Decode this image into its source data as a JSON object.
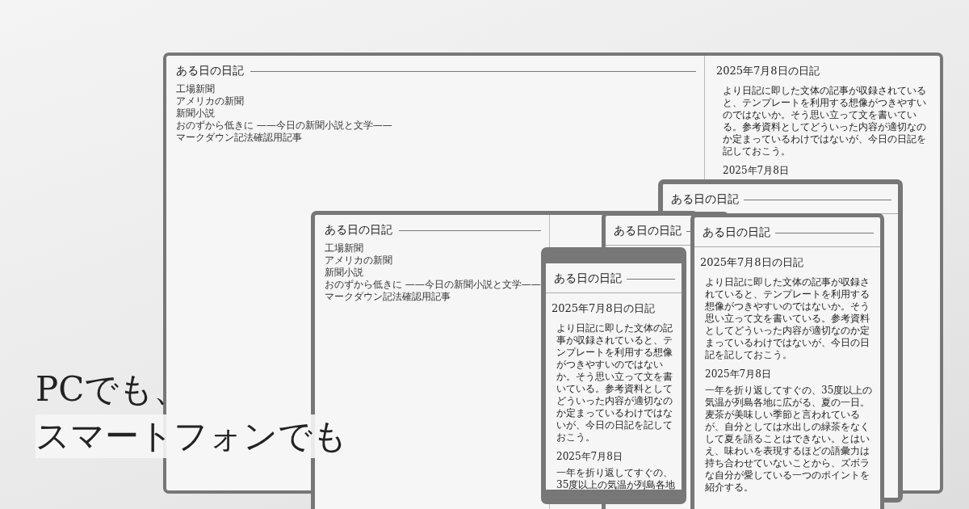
{
  "devices": [
    {
      "kind": "desktop",
      "title": "ある日の日記",
      "links": [
        "工場新聞",
        "アメリカの新聞",
        "新聞小説",
        "おのずから低きに ——今日の新聞小説と文学——",
        "マークダウン記法確認用記事"
      ],
      "heading": "2025年7月8日の日記",
      "blocks": [
        {
          "kind": "paragraph",
          "text": "より日記に即した文体の記事が収録されていると、テンプレートを利用する想像がつきやすいのではないか。そう思い立って文を書いている。参考資料としてどういった内容が適切なのか定まっているわけではないが、今日の日記を記しておこう。"
        },
        {
          "kind": "subheading",
          "text": "2025年7月8日"
        }
      ]
    },
    {
      "kind": "phone",
      "title": "ある日の日記"
    },
    {
      "kind": "desktop",
      "title": "ある日の日記",
      "links": [
        "工場新聞",
        "アメリカの新聞",
        "新聞小説",
        "おのずから低きに ——今日の新聞小説と文学——",
        "マークダウン記法確認用記事"
      ]
    },
    {
      "kind": "phone",
      "title": "ある日の日記"
    },
    {
      "kind": "phone",
      "title": "ある日の日記",
      "heading": "2025年7月8日の日記",
      "blocks": [
        {
          "kind": "paragraph",
          "text": "より日記に即した文体の記事が収録されていると、テンプレートを利用する想像がつきやすいのではないか。そう思い立って文を書いている。参考資料としてどういった内容が適切なのか定まっているわけではないが、今日の日記を記しておこう。"
        },
        {
          "kind": "subheading",
          "text": "2025年7月8日"
        },
        {
          "kind": "paragraph",
          "text": "一年を折り返してすぐの、35度以上の気温が列島各地"
        }
      ]
    },
    {
      "kind": "phone",
      "title": "ある日の日記",
      "heading": "2025年7月8日の日記",
      "blocks": [
        {
          "kind": "paragraph",
          "text": "より日記に即した文体の記事が収録されていると、テンプレートを利用する想像がつきやすいのではないか。そう思い立って文を書いている。参考資料としてどういった内容が適切なのか定まっているわけではないが、今日の日記を記しておこう。"
        },
        {
          "kind": "subheading",
          "text": "2025年7月8日"
        },
        {
          "kind": "paragraph",
          "text": "一年を折り返してすぐの、35度以上の気温が列島各地に広がる、夏の一日。麦茶が美味しい季節と言われているが、自分としては水出しの緑茶をなくして夏を語ることはできない。とはいえ、味わいを表現するほどの語彙力は持ち合わせていないことから、ズボラな自分が愛している一つのポイントを紹介する。"
        }
      ]
    }
  ],
  "headline": [
    "PCでも、",
    "スマートフォンでも"
  ]
}
